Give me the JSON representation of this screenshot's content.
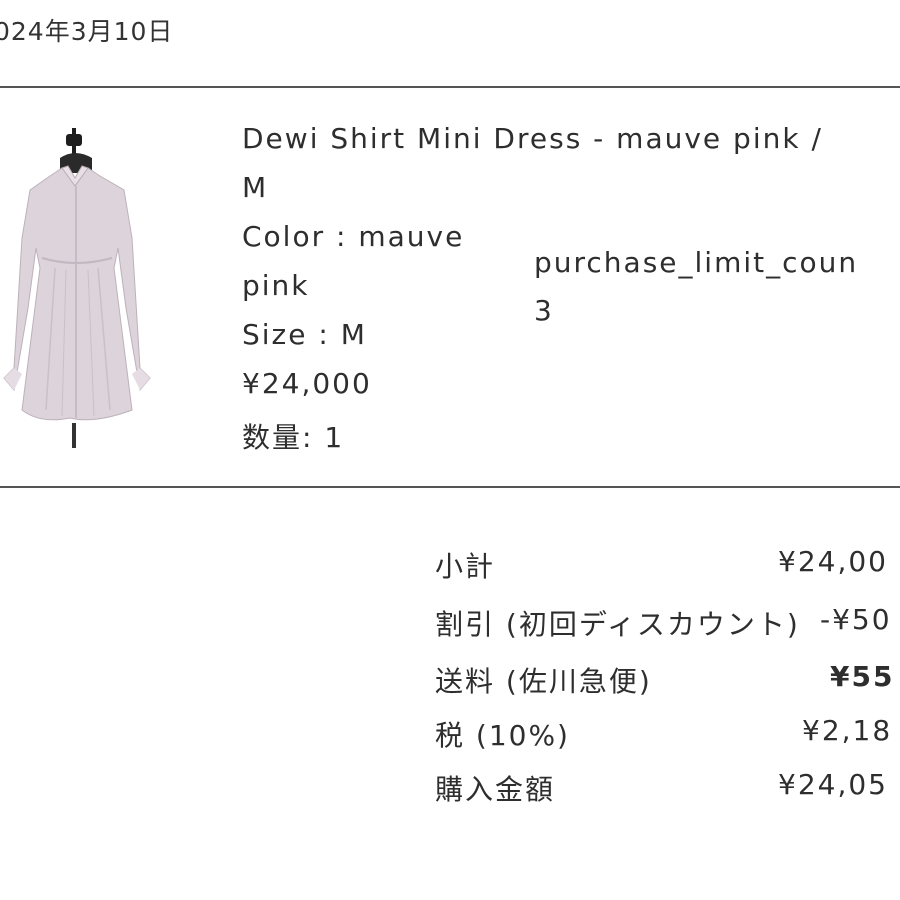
{
  "order_date": "024年3月10日",
  "item": {
    "title_line1": "Dewi Shirt Mini Dress - mauve pink /",
    "title_line2": "M",
    "color_line1": "Color : mauve",
    "color_line2": "pink",
    "size": "Size : M",
    "price": "¥24,000",
    "quantity": "数量: 1",
    "purchase_limit_label": "purchase_limit_coun",
    "purchase_limit_value": "3",
    "image_color": "#ddd3db"
  },
  "summary": {
    "subtotal_label": "小計",
    "subtotal_value": "¥24,00",
    "discount_label": "割引 (初回ディスカウント)",
    "discount_value": "-¥50",
    "shipping_label": "送料 (佐川急便)",
    "shipping_value": "¥55",
    "tax_label": "税 (10%)",
    "tax_value": "¥2,18",
    "total_label": "購入金額",
    "total_value": "¥24,05"
  }
}
